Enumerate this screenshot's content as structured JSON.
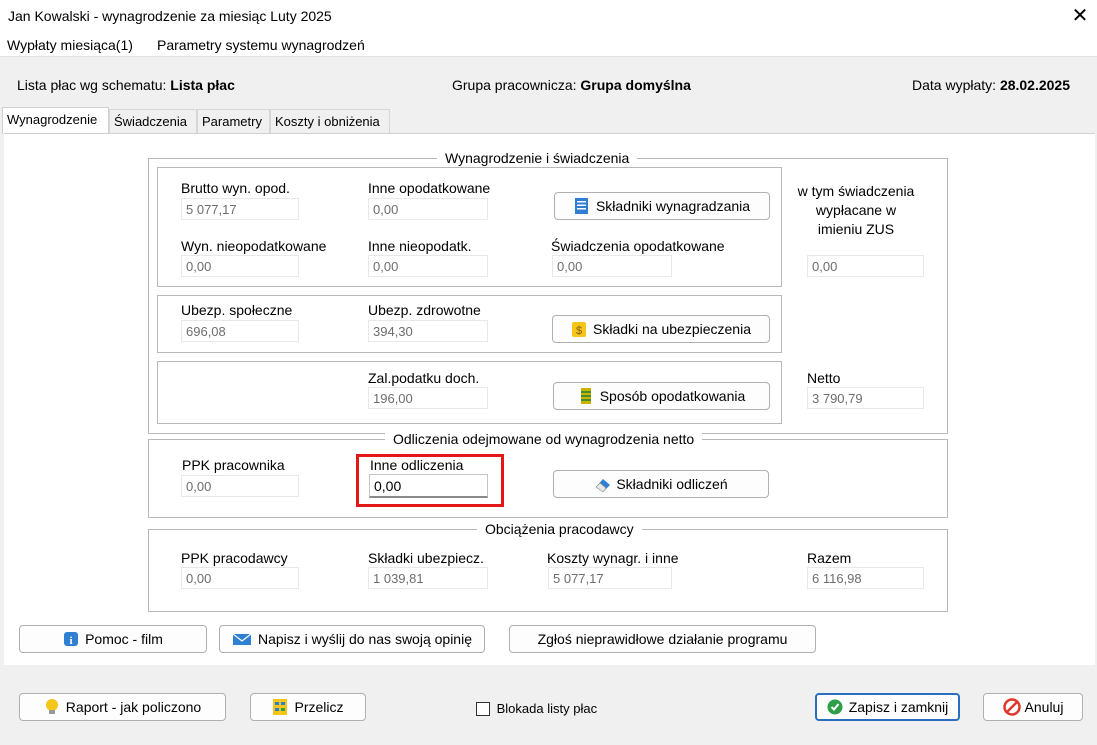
{
  "window": {
    "title": "Jan Kowalski - wynagrodzenie za miesiąc Luty 2025",
    "close_glyph": "✕"
  },
  "menu": {
    "items": [
      "Wypłaty miesiąca(1)",
      "Parametry systemu wynagrodzeń"
    ]
  },
  "info": {
    "schema_label": "Lista płac wg schematu:",
    "schema_value": "Lista płac",
    "group_label": "Grupa pracownicza:",
    "group_value": "Grupa domyślna",
    "date_label": "Data wypłaty:",
    "date_value": "28.02.2025"
  },
  "tabs": [
    "Wynagrodzenie",
    "Świadczenia",
    "Parametry",
    "Koszty i obniżenia"
  ],
  "salary_group": {
    "title": "Wynagrodzenie i świadczenia",
    "brutto_label": "Brutto wyn. opod.",
    "brutto_value": "5 077,17",
    "inne_opod_label": "Inne opodatkowane",
    "inne_opod_value": "0,00",
    "skladniki_button": "Składniki wynagradzania",
    "wyn_nieopod_label": "Wyn. nieopodatkowane",
    "wyn_nieopod_value": "0,00",
    "inne_nieopod_label": "Inne nieopodatk.",
    "inne_nieopod_value": "0,00",
    "swiad_opod_label": "Świadczenia opodatkowane",
    "swiad_opod_value": "0,00",
    "zus_label": "w tym świadczenia wypłacane w imieniu ZUS",
    "zus_value": "0,00",
    "ubezp_spol_label": "Ubezp. społeczne",
    "ubezp_spol_value": "696,08",
    "ubezp_zdrow_label": "Ubezp. zdrowotne",
    "ubezp_zdrow_value": "394,30",
    "skladki_button": "Składki na ubezpieczenia",
    "zal_label": "Zal.podatku doch.",
    "zal_value": "196,00",
    "sposob_button": "Sposób opodatkowania",
    "netto_label": "Netto",
    "netto_value": "3 790,79"
  },
  "deductions_group": {
    "title": "Odliczenia odejmowane od wynagrodzenia netto",
    "ppk_label": "PPK pracownika",
    "ppk_value": "0,00",
    "inne_label": "Inne odliczenia",
    "inne_value": "0,00",
    "skladniki_button": "Składniki odliczeń"
  },
  "employer_group": {
    "title": "Obciążenia pracodawcy",
    "ppk_label": "PPK pracodawcy",
    "ppk_value": "0,00",
    "skladki_label": "Składki ubezpiecz.",
    "skladki_value": "1 039,81",
    "koszty_label": "Koszty wynagr. i inne",
    "koszty_value": "5 077,17",
    "razem_label": "Razem",
    "razem_value": "6 116,98"
  },
  "help_buttons": {
    "pomoc": "Pomoc - film",
    "opinia": "Napisz i wyślij do nas swoją opinię",
    "zglos": "Zgłoś nieprawidłowe działanie programu"
  },
  "footer": {
    "raport": "Raport - jak policzono",
    "przelicz": "Przelicz",
    "blokada": "Blokada listy płac",
    "zapisz": "Zapisz i zamknij",
    "anuluj": "Anuluj"
  },
  "colors": {
    "highlight_border": "#e31717",
    "ok_green": "#2e9e48",
    "cancel_red": "#e0362c",
    "info_blue": "#2f7fd3"
  }
}
